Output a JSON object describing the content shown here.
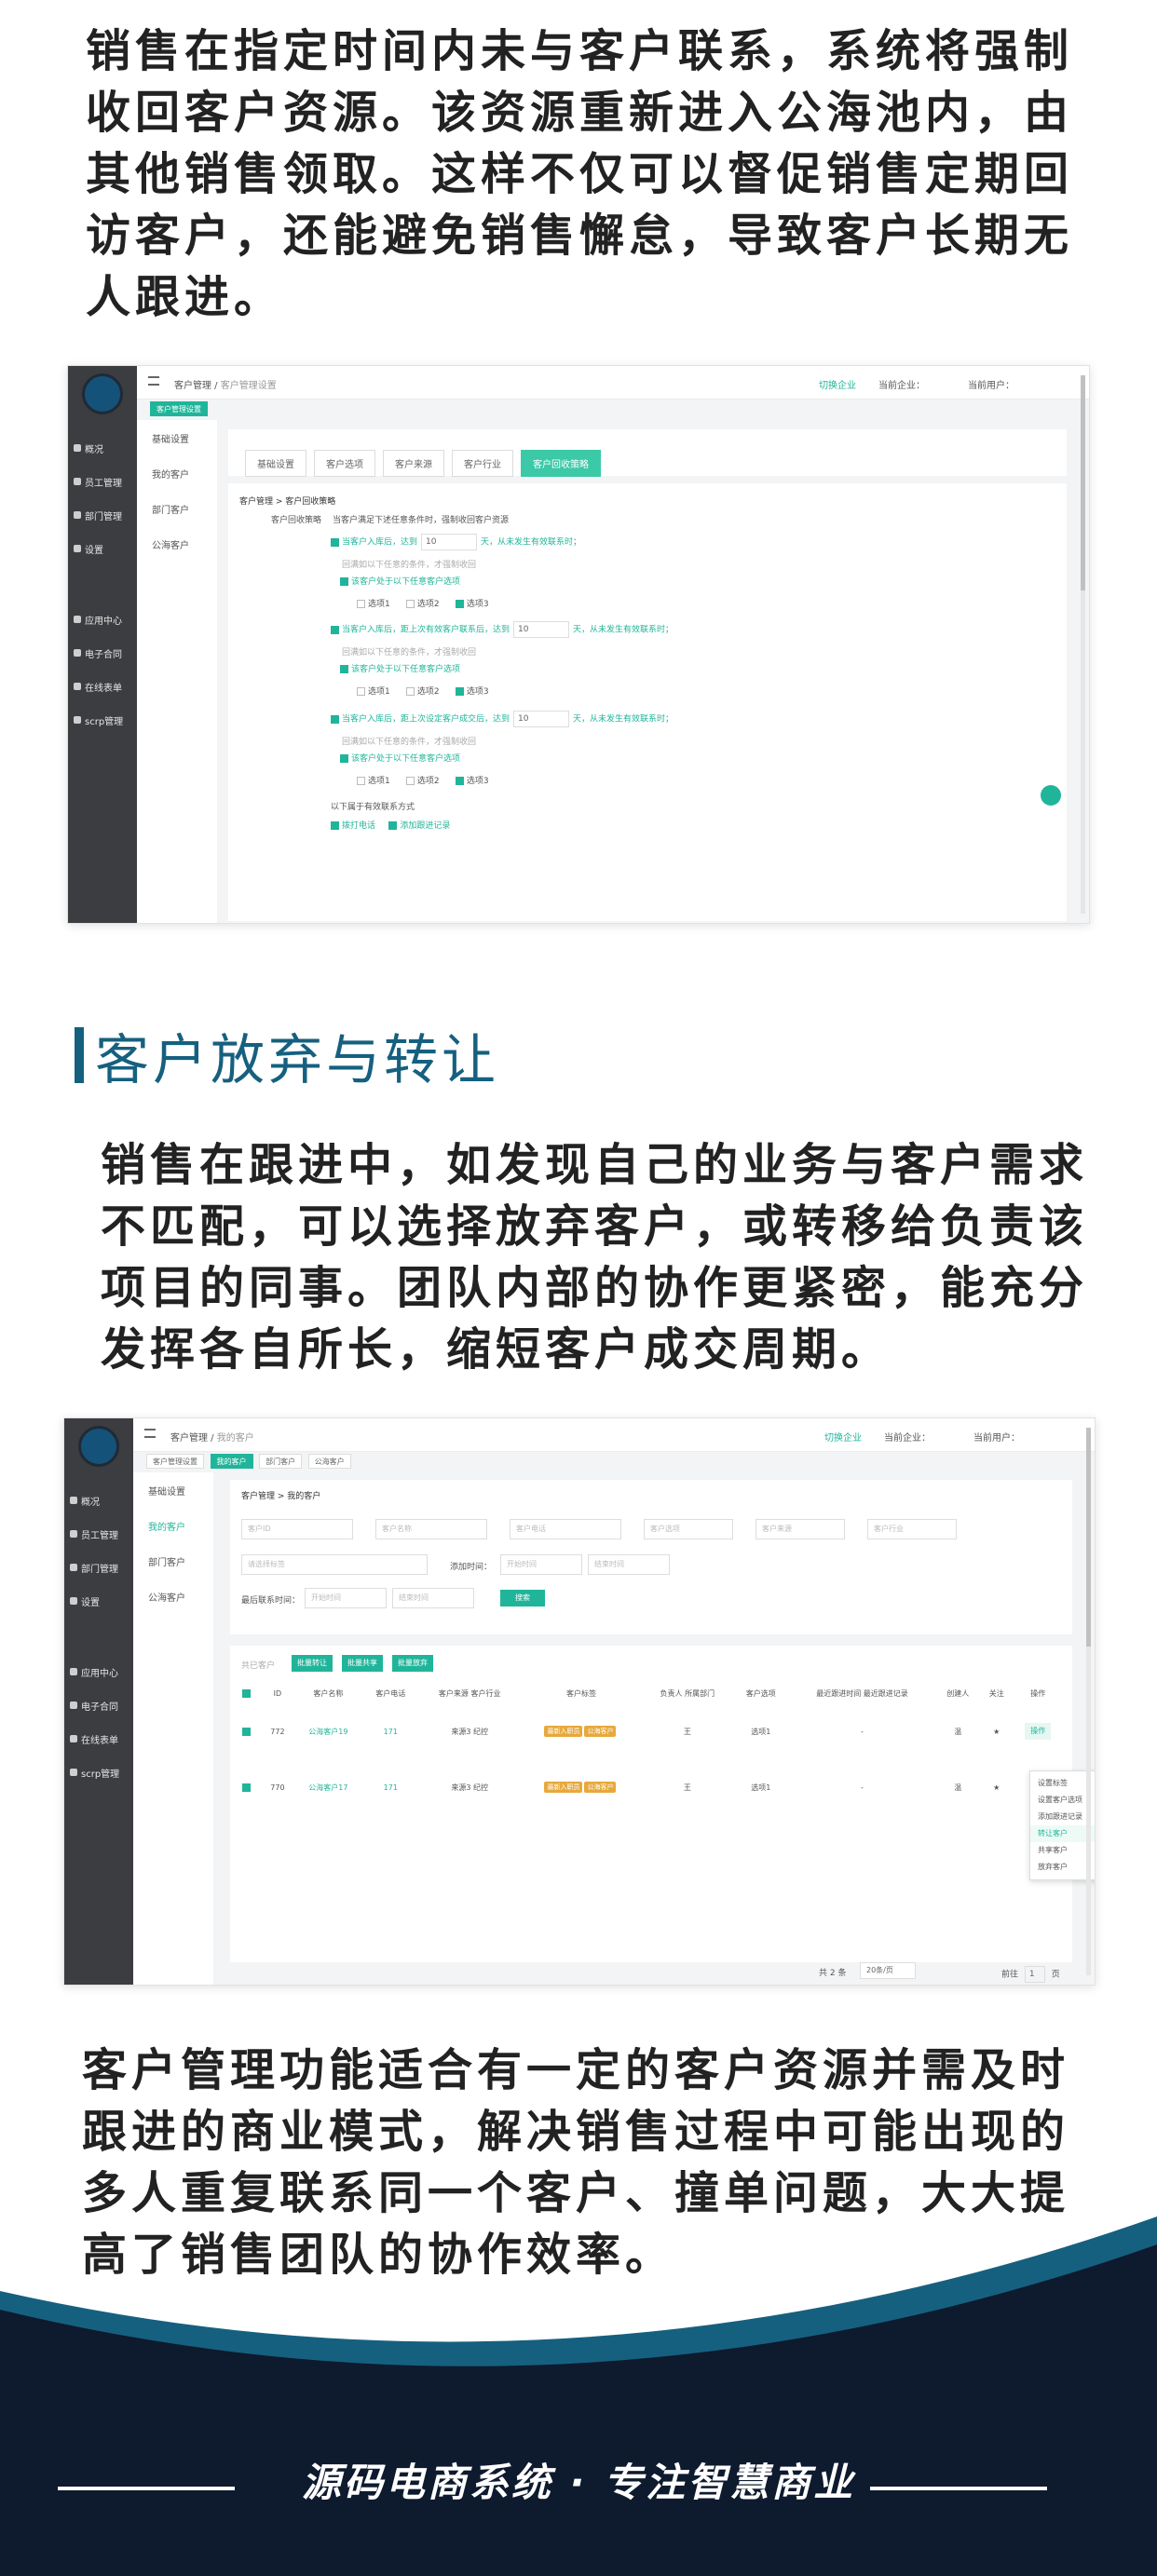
{
  "paragraphs": {
    "p1": "销售在指定时间内未与客户联系，系统将强制收回客户资源。该资源重新进入公海池内，由其他销售领取。这样不仅可以督促销售定期回访客户，还能避免销售懈怠，导致客户长期无人跟进。",
    "p2": "销售在跟进中，如发现自己的业务与客户需求不匹配，可以选择放弃客户，或转移给负责该项目的同事。团队内部的协作更紧密，能充分发挥各自所长，缩短客户成交周期。",
    "p3": "客户管理功能适合有一定的客户资源并需及时跟进的商业模式，解决销售过程中可能出现的多人重复联系同一个客户、撞单问题，大大提高了销售团队的协作效率。"
  },
  "section_title": "客户放弃与转让",
  "footer": {
    "slogan": "源码电商系统 · 专注智慧商业",
    "bg": "#0e1a2e",
    "accent": "#16607f"
  },
  "app": {
    "sidebar": [
      "概况",
      "员工管理",
      "部门管理",
      "设置",
      "应用中心",
      "电子合同",
      "在线表单",
      "scrp管理"
    ],
    "sub_nav": [
      "基础设置",
      "我的客户",
      "部门客户",
      "公海客户"
    ],
    "breadcrumb_root": "客户管理",
    "top_switch": "切换企业",
    "top_company": "当前企业：",
    "top_user": "当前用户："
  },
  "shot1": {
    "breadcrumb_page": "客户管理设置",
    "tag": "客户管理设置",
    "tabs": [
      "基础设置",
      "客户选项",
      "客户来源",
      "客户行业",
      "客户回收策略"
    ],
    "section_head": "客户管理 > 客户回收策略",
    "policy_label": "客户回收策略",
    "policy_desc": "当客户满足下述任意条件时，强制收回客户资源",
    "rule1": "当客户入库后，达到",
    "rule1_val": "10",
    "rule1_end": "天，从未发生有效联系时；",
    "rule2": "当客户入库后，距上次有效客户联系后，达到",
    "rule2_val": "10",
    "rule2_end": "天，从未发生有效联系时；",
    "rule3": "当客户入库后，距上次设定客户成交后，达到",
    "rule3_val": "10",
    "rule3_end": "天，从未发生有效联系时；",
    "note": "回满如以下任意的条件，才强制收回",
    "subcheck": "该客户处于以下任意客户选项",
    "options": [
      "选项1",
      "选项2",
      "选项3"
    ],
    "valid_contact": "以下属于有效联系方式",
    "contact_opts": [
      "拨打电话",
      "添加跟进记录"
    ]
  },
  "shot2": {
    "breadcrumb_page": "我的客户",
    "tags": [
      "客户管理设置",
      "我的客户",
      "部门客户",
      "公海客户"
    ],
    "section_head": "客户管理 > 我的客户",
    "filters": [
      "客户ID",
      "客户名称",
      "客户电话",
      "客户选项",
      "客户来源",
      "客户行业",
      "请选择标签"
    ],
    "add_time": "添加时间：",
    "last_contact": "最后联系时间：",
    "start": "开始时间",
    "end": "结束时间",
    "search_btn": "搜索",
    "bulk": [
      "共已客户",
      "批量转让",
      "批量共享",
      "批量放弃"
    ],
    "headers": [
      "ID",
      "客户名称",
      "客户电话",
      "客户来源 客户行业",
      "客户标签",
      "负责人 所属部门",
      "客户选项",
      "最近跟进时间 最近跟进记录",
      "创建人",
      "关注",
      "操作"
    ],
    "rows": [
      {
        "id": "772",
        "name": "公海客户19",
        "phone": "171",
        "src": "来源3 纪控",
        "tags": [
          "最新入职员",
          "公海客户"
        ],
        "owner": "王",
        "opt": "选项1",
        "follow": "-",
        "creator": "温"
      },
      {
        "id": "770",
        "name": "公海客户17",
        "phone": "171",
        "src": "来源3 纪控",
        "tags": [
          "最新入职员",
          "公海客户"
        ],
        "owner": "王",
        "opt": "选项1",
        "follow": "-",
        "creator": "温"
      }
    ],
    "op_btn": "操作",
    "menu": [
      "设置标签",
      "设置客户选项",
      "添加跟进记录",
      "转让客户",
      "共享客户",
      "放弃客户"
    ],
    "pager_total": "共 2 条",
    "pager_size": "20条/页",
    "pager_goto": "前往",
    "pager_page": "1",
    "pager_unit": "页"
  }
}
